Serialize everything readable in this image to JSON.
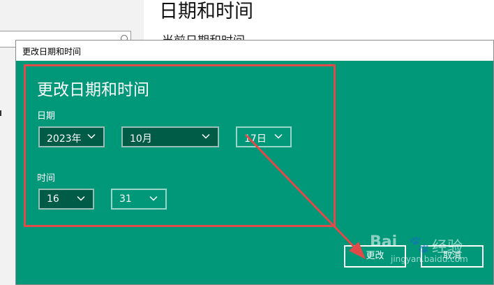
{
  "background": {
    "page_title": "日期和时间",
    "subtitle": "当前日期和时间"
  },
  "dialog": {
    "window_title": "更改日期和时间",
    "heading": "更改日期和时间",
    "date_label": "日期",
    "time_label": "时间",
    "year": "2023年",
    "month": "10月",
    "day": "17日",
    "hour": "16",
    "minute": "31",
    "change_button": "更改",
    "cancel_button": "取消"
  },
  "watermark": {
    "brand": "Bai",
    "paw": "🐾",
    "experience": "经验",
    "url": "jingyan.baidu.com"
  },
  "colors": {
    "dialog_bg": "#009879",
    "dropdown_selected_bg": "#005c47",
    "annotation": "#e04a48"
  },
  "icons": {
    "dropdown": "chevron-down-icon",
    "search": "search-icon"
  }
}
